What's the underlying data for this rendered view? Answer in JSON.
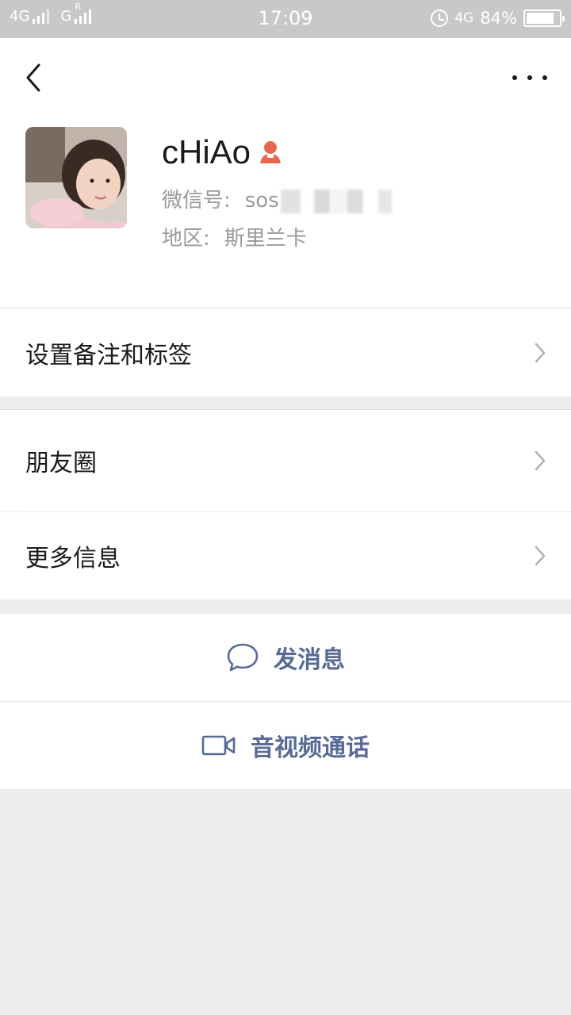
{
  "status_bar": {
    "network1": "4G",
    "network2": "G",
    "roaming": "R",
    "time": "17:09",
    "network3": "4G",
    "battery_percent": "84%",
    "battery_level": 0.84
  },
  "profile": {
    "name": "cHiAo",
    "wechat_id_label": "微信号:",
    "wechat_id_value": "sos",
    "region_label": "地区:",
    "region_value": "斯里兰卡"
  },
  "menu": {
    "remark_tags": "设置备注和标签",
    "moments": "朋友圈",
    "more_info": "更多信息"
  },
  "actions": {
    "send_message": "发消息",
    "video_call": "音视频通话"
  },
  "colors": {
    "link": "#576b95",
    "gender_icon": "#e9674f",
    "status_bar": "#c8c8c8",
    "background": "#ededed"
  },
  "icons": [
    "back-arrow-icon",
    "more-dots-icon",
    "gender-female-icon",
    "chevron-right-icon",
    "chat-bubble-icon",
    "video-camera-icon"
  ]
}
